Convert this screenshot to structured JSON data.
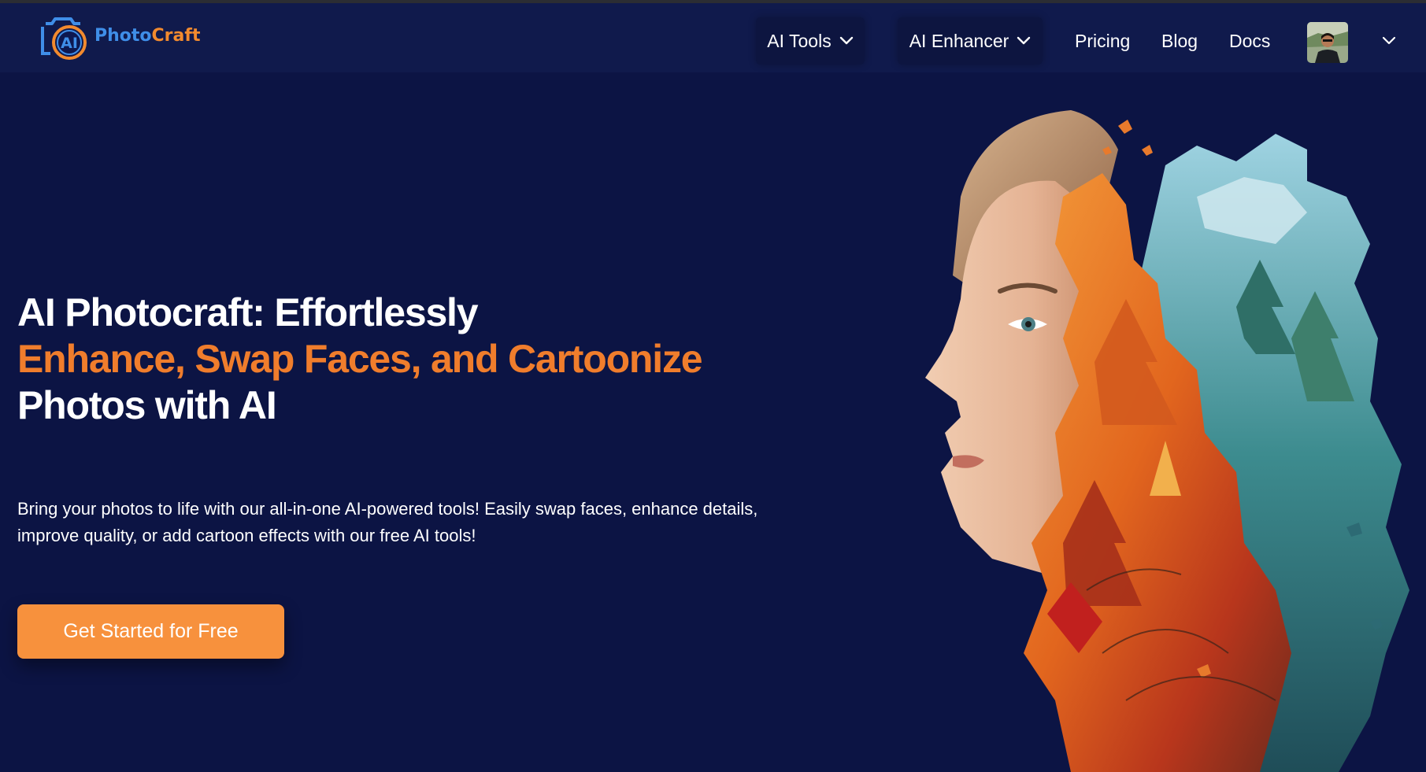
{
  "brand": {
    "logo_mark": "AI",
    "name_part1": "Photo",
    "name_part2": "Craft",
    "colors": {
      "blue": "#3f8ee8",
      "orange": "#f28a2e"
    }
  },
  "nav": {
    "ai_tools_label": "AI Tools",
    "ai_enhancer_label": "AI Enhancer",
    "pricing_label": "Pricing",
    "blog_label": "Blog",
    "docs_label": "Docs",
    "dropdown_icon": "chevron-down-icon"
  },
  "hero": {
    "headline_line1": "AI Photocraft: Effortlessly",
    "headline_line2": "Enhance, Swap Faces, and Cartoonize",
    "headline_line3": "Photos with AI",
    "description": "Bring your photos to life with our all-in-one AI-powered tools! Easily swap faces, enhance details, improve quality, or add cartoon effects with our free AI tools!",
    "cta_label": "Get Started for Free"
  },
  "theme": {
    "background": "#0c1444",
    "navbar": "#101a4c",
    "accent": "#f7913d",
    "headline_orange": "#f07d2c"
  }
}
